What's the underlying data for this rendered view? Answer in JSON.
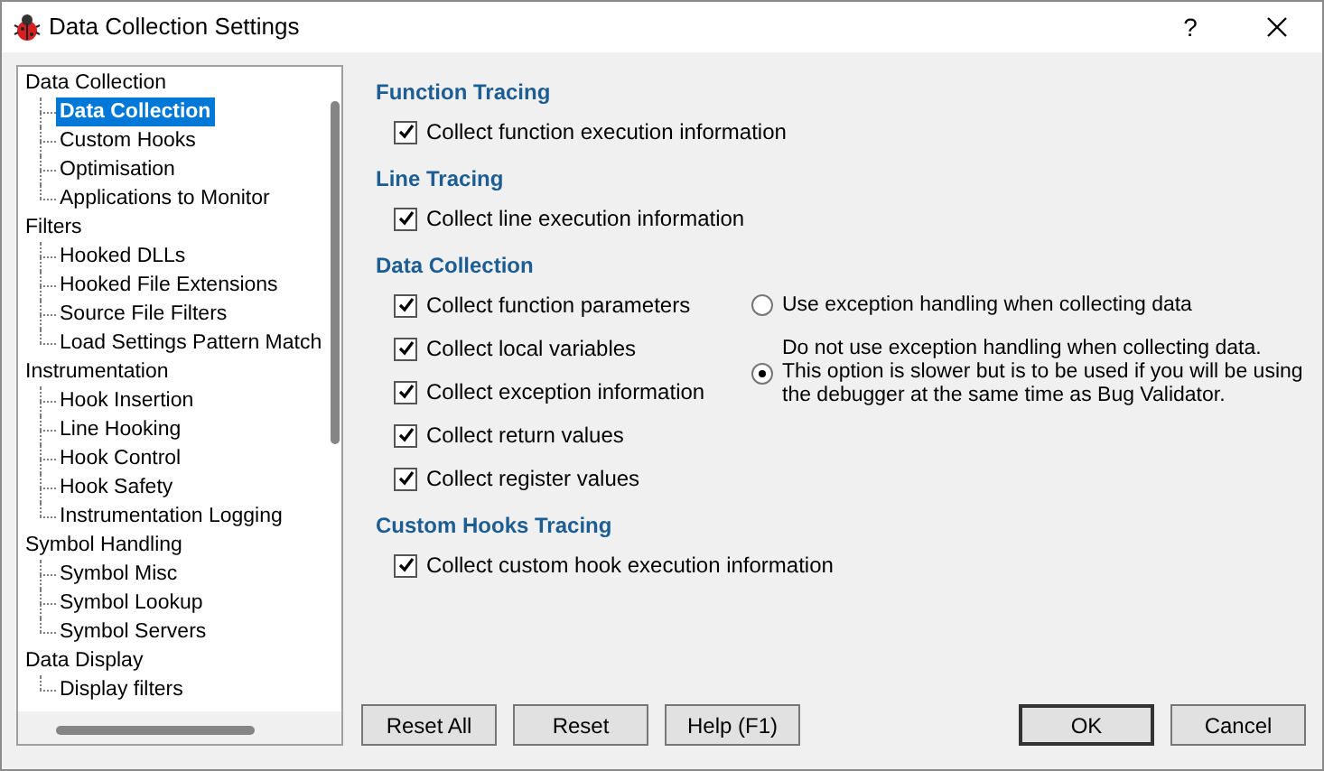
{
  "window": {
    "title": "Data Collection Settings",
    "help_button": "?"
  },
  "tree": [
    {
      "label": "Data Collection",
      "selected": false,
      "children": [
        {
          "label": "Data Collection",
          "selected": true
        },
        {
          "label": "Custom Hooks",
          "selected": false
        },
        {
          "label": "Optimisation",
          "selected": false
        },
        {
          "label": "Applications to Monitor",
          "selected": false
        }
      ]
    },
    {
      "label": "Filters",
      "selected": false,
      "children": [
        {
          "label": "Hooked DLLs",
          "selected": false
        },
        {
          "label": "Hooked File Extensions",
          "selected": false
        },
        {
          "label": "Source File Filters",
          "selected": false
        },
        {
          "label": "Load Settings Pattern Match",
          "selected": false
        }
      ]
    },
    {
      "label": "Instrumentation",
      "selected": false,
      "children": [
        {
          "label": "Hook Insertion",
          "selected": false
        },
        {
          "label": "Line Hooking",
          "selected": false
        },
        {
          "label": "Hook Control",
          "selected": false
        },
        {
          "label": "Hook Safety",
          "selected": false
        },
        {
          "label": "Instrumentation Logging",
          "selected": false
        }
      ]
    },
    {
      "label": "Symbol Handling",
      "selected": false,
      "children": [
        {
          "label": "Symbol Misc",
          "selected": false
        },
        {
          "label": "Symbol Lookup",
          "selected": false
        },
        {
          "label": "Symbol Servers",
          "selected": false
        }
      ]
    },
    {
      "label": "Data Display",
      "selected": false,
      "children": [
        {
          "label": "Display filters",
          "selected": false
        }
      ]
    }
  ],
  "sections": [
    {
      "heading": "Function Tracing",
      "options": [
        {
          "label": "Collect function execution information",
          "checked": true
        }
      ]
    },
    {
      "heading": "Line Tracing",
      "options": [
        {
          "label": "Collect line execution information",
          "checked": true
        }
      ]
    },
    {
      "heading": "Data Collection",
      "options": [
        {
          "label": "Collect function parameters",
          "checked": true
        },
        {
          "label": "Collect local variables",
          "checked": true
        },
        {
          "label": "Collect exception information",
          "checked": true
        },
        {
          "label": "Collect return values",
          "checked": true
        },
        {
          "label": "Collect register values",
          "checked": true
        }
      ],
      "radios": [
        {
          "label": "Use exception handling when collecting data",
          "selected": false
        },
        {
          "label": "Do not use exception handling when collecting data. This option is slower but is to be used if you will be using the debugger at the same time as Bug Validator.",
          "selected": true
        }
      ]
    },
    {
      "heading": "Custom Hooks Tracing",
      "options": [
        {
          "label": "Collect custom hook execution information",
          "checked": true
        }
      ]
    }
  ],
  "buttons": [
    {
      "label": "Reset All",
      "default": false
    },
    {
      "label": "Reset",
      "default": false
    },
    {
      "label": "Help (F1)",
      "default": false
    },
    {
      "label": "OK",
      "default": true
    },
    {
      "label": "Cancel",
      "default": false
    }
  ]
}
